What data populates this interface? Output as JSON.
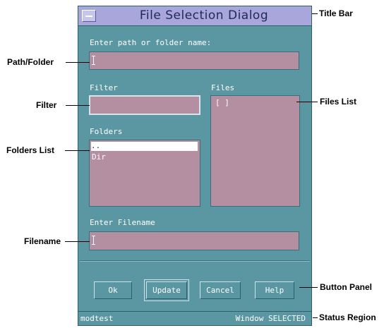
{
  "dialog": {
    "title": "File Selection Dialog",
    "path_label": "Enter path or folder name:",
    "path_value": "",
    "filter_label": "Filter",
    "filter_value": "",
    "files_label": "Files",
    "files_items": [
      "[ ]"
    ],
    "folders_label": "Folders",
    "folders_items": [
      "..",
      "Dir"
    ],
    "filename_label": "Enter Filename",
    "filename_value": "",
    "buttons": {
      "ok": "Ok",
      "update": "Update",
      "cancel": "Cancel",
      "help": "Help"
    },
    "status_left": "modtest",
    "status_right": "Window SELECTED"
  },
  "callouts": {
    "title_bar": "Title Bar",
    "path_folder": "Path/Folder",
    "filter": "Filter",
    "files_list": "Files List",
    "folders_list": "Folders List",
    "filename": "Filename",
    "button_panel": "Button Panel",
    "status_region": "Status Region"
  },
  "colors": {
    "panel": "#5a97a3",
    "title_bar": "#a9a6dc",
    "field": "#b48ea1"
  }
}
